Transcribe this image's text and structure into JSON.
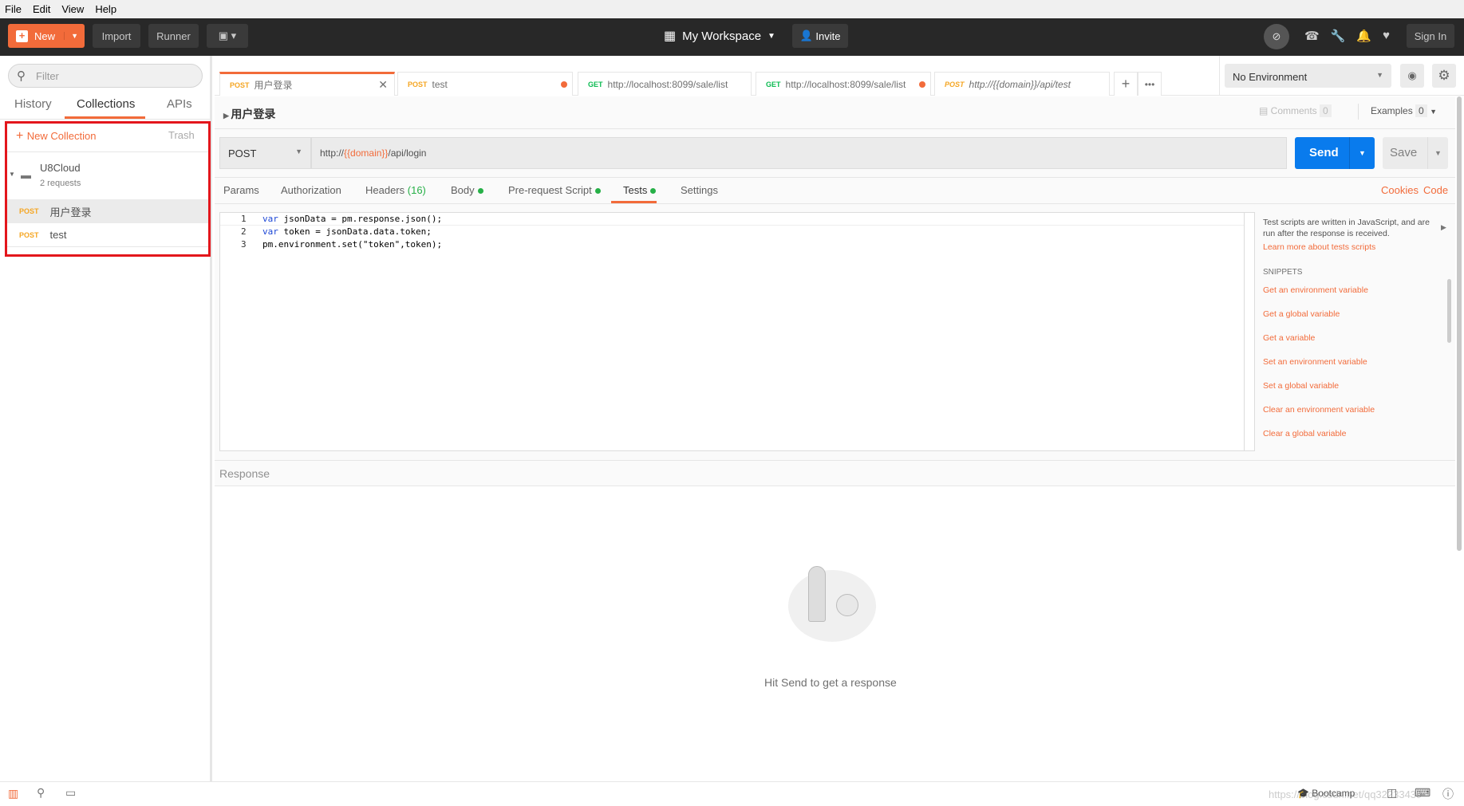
{
  "menu": [
    "File",
    "Edit",
    "View",
    "Help"
  ],
  "topbar": {
    "new": "New",
    "import": "Import",
    "runner": "Runner",
    "workspace": "My Workspace",
    "invite": "Invite",
    "sign_in": "Sign In"
  },
  "sidebar": {
    "filter_placeholder": "Filter",
    "tabs": [
      "History",
      "Collections",
      "APIs"
    ],
    "new_collection": "New Collection",
    "trash": "Trash",
    "collection": {
      "name": "U8Cloud",
      "count": "2 requests",
      "requests": [
        {
          "method": "POST",
          "name": "用户登录"
        },
        {
          "method": "POST",
          "name": "test"
        }
      ]
    }
  },
  "tabs": [
    {
      "method": "POST",
      "label": "用户登录"
    },
    {
      "method": "POST",
      "label": "test"
    },
    {
      "method": "GET",
      "label": "http://localhost:8099/sale/list"
    },
    {
      "method": "GET",
      "label": "http://localhost:8099/sale/list"
    },
    {
      "method": "POST",
      "label": "http://{{domain}}/api/test"
    }
  ],
  "environment": "No Environment",
  "request": {
    "name": "用户登录",
    "comments": "Comments",
    "comments_count": "0",
    "examples": "Examples",
    "examples_count": "0",
    "method": "POST",
    "url_prefix": "http://",
    "url_var": "{{domain}}",
    "url_suffix": "/api/login",
    "send": "Send",
    "save": "Save"
  },
  "subtabs": [
    "Params",
    "Authorization",
    "Headers",
    "(16)",
    "Body",
    "Pre-request Script",
    "Tests",
    "Settings"
  ],
  "cookies": "Cookies",
  "code_link": "Code",
  "code_lines": [
    [
      "1",
      "var",
      " jsonData = pm.response.json();"
    ],
    [
      "2",
      "var",
      " token = jsonData.data.token;"
    ],
    [
      "3",
      "",
      "pm.environment.set(\"token\",token);"
    ]
  ],
  "help": {
    "text1": "Test scripts are written in JavaScript, and are",
    "text2": "run after the response is received.",
    "learn": "Learn more about tests scripts",
    "snippets_title": "SNIPPETS",
    "snippets": [
      "Get an environment variable",
      "Get a global variable",
      "Get a variable",
      "Set an environment variable",
      "Set a global variable",
      "Clear an environment variable",
      "Clear a global variable"
    ]
  },
  "response": {
    "title": "Response",
    "empty": "Hit Send to get a response"
  },
  "statusbar": {
    "bootcamp": "Bootcamp",
    "watermark": "https://blog.csdn.net/qq32233439"
  }
}
